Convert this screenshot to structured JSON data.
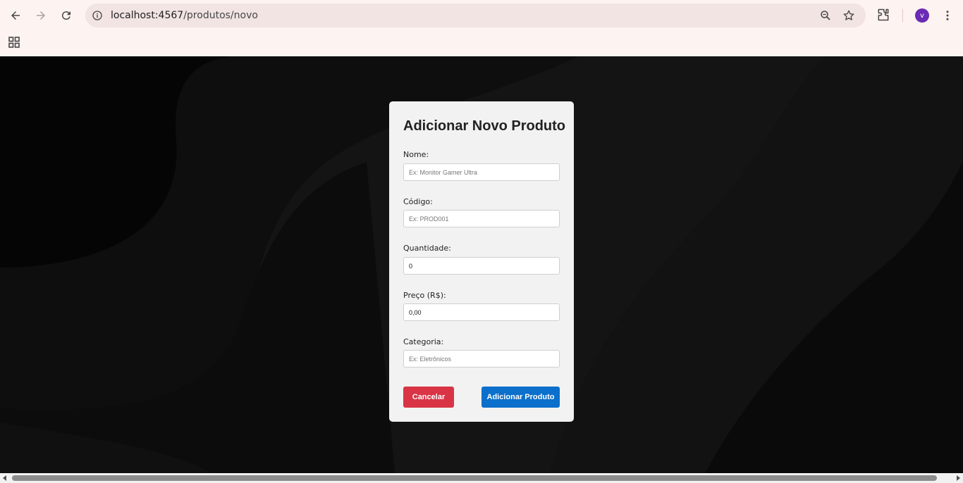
{
  "browser": {
    "url_host": "localhost:4567",
    "url_path": "/produtos/novo",
    "profile_initial": "v"
  },
  "form": {
    "title": "Adicionar Novo Produto",
    "fields": [
      {
        "label": "Nome:",
        "placeholder": "Ex: Monitor Gamer Ultra",
        "value": ""
      },
      {
        "label": "Código:",
        "placeholder": "Ex: PROD001",
        "value": ""
      },
      {
        "label": "Quantidade:",
        "placeholder": "",
        "value": "0"
      },
      {
        "label": "Preço (R$):",
        "placeholder": "",
        "value": "0,00"
      },
      {
        "label": "Categoria:",
        "placeholder": "Ex: Eletrônicos",
        "value": ""
      }
    ],
    "cancel_label": "Cancelar",
    "submit_label": "Adicionar Produto"
  },
  "colors": {
    "cancel": "#d93446",
    "submit": "#0b6fcb",
    "avatar": "#6b2bb3"
  }
}
